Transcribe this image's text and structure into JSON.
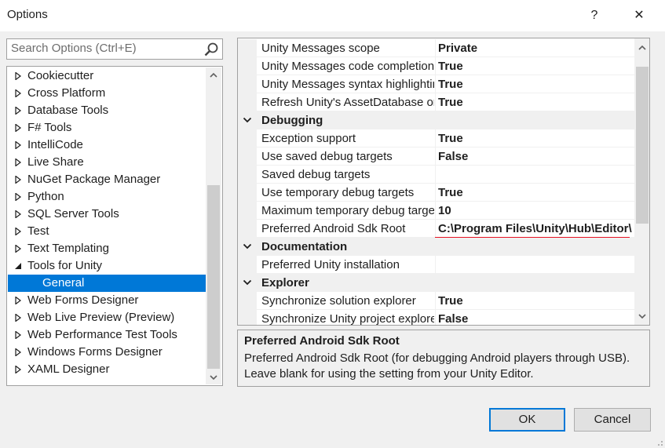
{
  "window": {
    "title": "Options",
    "help_glyph": "?",
    "close_glyph": "✕"
  },
  "search": {
    "placeholder": "Search Options (Ctrl+E)"
  },
  "tree": {
    "items": [
      {
        "label": "Cookiecutter",
        "state": "collapsed"
      },
      {
        "label": "Cross Platform",
        "state": "collapsed"
      },
      {
        "label": "Database Tools",
        "state": "collapsed"
      },
      {
        "label": "F# Tools",
        "state": "collapsed"
      },
      {
        "label": "IntelliCode",
        "state": "collapsed"
      },
      {
        "label": "Live Share",
        "state": "collapsed"
      },
      {
        "label": "NuGet Package Manager",
        "state": "collapsed"
      },
      {
        "label": "Python",
        "state": "collapsed"
      },
      {
        "label": "SQL Server Tools",
        "state": "collapsed"
      },
      {
        "label": "Test",
        "state": "collapsed"
      },
      {
        "label": "Text Templating",
        "state": "collapsed"
      },
      {
        "label": "Tools for Unity",
        "state": "expanded"
      },
      {
        "label": "General",
        "state": "child-selected"
      },
      {
        "label": "Web Forms Designer",
        "state": "collapsed"
      },
      {
        "label": "Web Live Preview (Preview)",
        "state": "collapsed"
      },
      {
        "label": "Web Performance Test Tools",
        "state": "collapsed"
      },
      {
        "label": "Windows Forms Designer",
        "state": "collapsed"
      },
      {
        "label": "XAML Designer",
        "state": "collapsed"
      }
    ]
  },
  "properties": {
    "rows": [
      {
        "kind": "prop",
        "name": "Unity Messages scope",
        "value": "Private"
      },
      {
        "kind": "prop",
        "name": "Unity Messages code completion",
        "value": "True"
      },
      {
        "kind": "prop",
        "name": "Unity Messages syntax highlighting",
        "value": "True"
      },
      {
        "kind": "prop",
        "name": "Refresh Unity's AssetDatabase on save",
        "value": "True"
      },
      {
        "kind": "category",
        "name": "Debugging"
      },
      {
        "kind": "prop",
        "name": "Exception support",
        "value": "True"
      },
      {
        "kind": "prop",
        "name": "Use saved debug targets",
        "value": "False"
      },
      {
        "kind": "prop",
        "name": "Saved debug targets",
        "value": ""
      },
      {
        "kind": "prop",
        "name": "Use temporary debug targets",
        "value": "True"
      },
      {
        "kind": "prop",
        "name": "Maximum temporary debug targets",
        "value": "10"
      },
      {
        "kind": "prop",
        "name": "Preferred Android Sdk Root",
        "value": "C:\\Program Files\\Unity\\Hub\\Editor\\",
        "highlight": true
      },
      {
        "kind": "category",
        "name": "Documentation"
      },
      {
        "kind": "prop",
        "name": "Preferred Unity installation",
        "value": ""
      },
      {
        "kind": "category",
        "name": "Explorer"
      },
      {
        "kind": "prop",
        "name": "Synchronize solution explorer",
        "value": "True"
      },
      {
        "kind": "prop",
        "name": "Synchronize Unity project explorer",
        "value": "False"
      }
    ]
  },
  "description": {
    "title": "Preferred Android Sdk Root",
    "text": "Preferred Android Sdk Root (for debugging Android players through USB). Leave blank for using the setting from your Unity Editor."
  },
  "buttons": {
    "ok": "OK",
    "cancel": "Cancel"
  },
  "colors": {
    "selection": "#0078d7",
    "highlight_underline": "#e81123"
  }
}
